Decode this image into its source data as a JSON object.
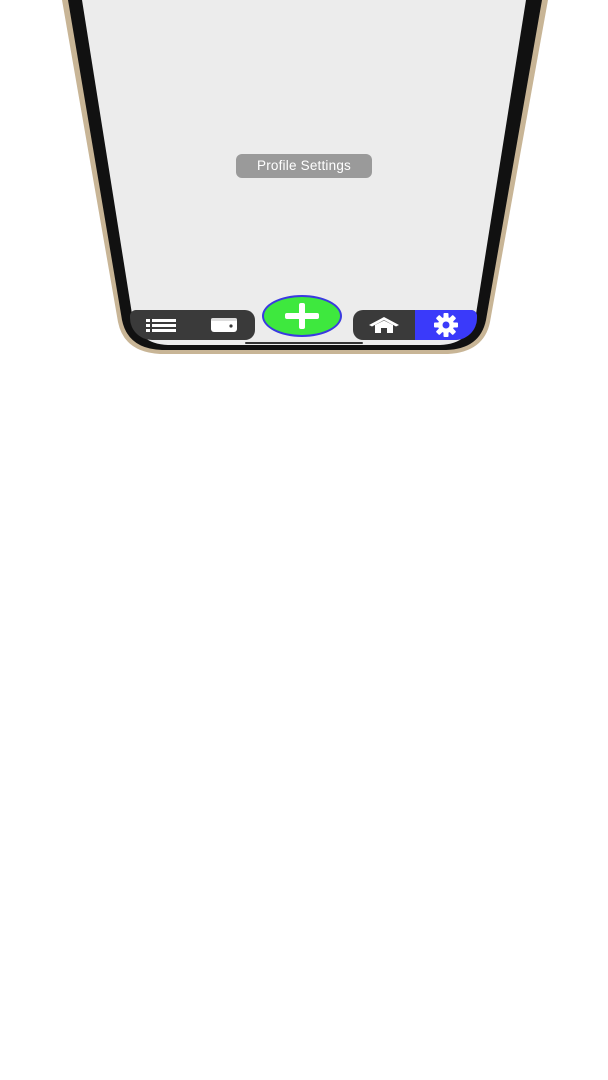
{
  "colors": {
    "accent": "#3a3afa",
    "fab": "#3ee83e",
    "fab_border": "#3a3ae0",
    "tab_bar": "#3a3a3a",
    "screen": "#ececec",
    "bezel": "#111111",
    "frame_gold": "#c8b596"
  },
  "screen": {
    "tooltip_label": "Profile Settings"
  },
  "tab_bar": {
    "left_items": [
      {
        "icon": "list-icon"
      },
      {
        "icon": "wallet-icon"
      }
    ],
    "fab": {
      "icon": "plus-icon"
    },
    "right_items": [
      {
        "icon": "home-icon"
      },
      {
        "icon": "gear-icon",
        "active": true
      }
    ]
  }
}
